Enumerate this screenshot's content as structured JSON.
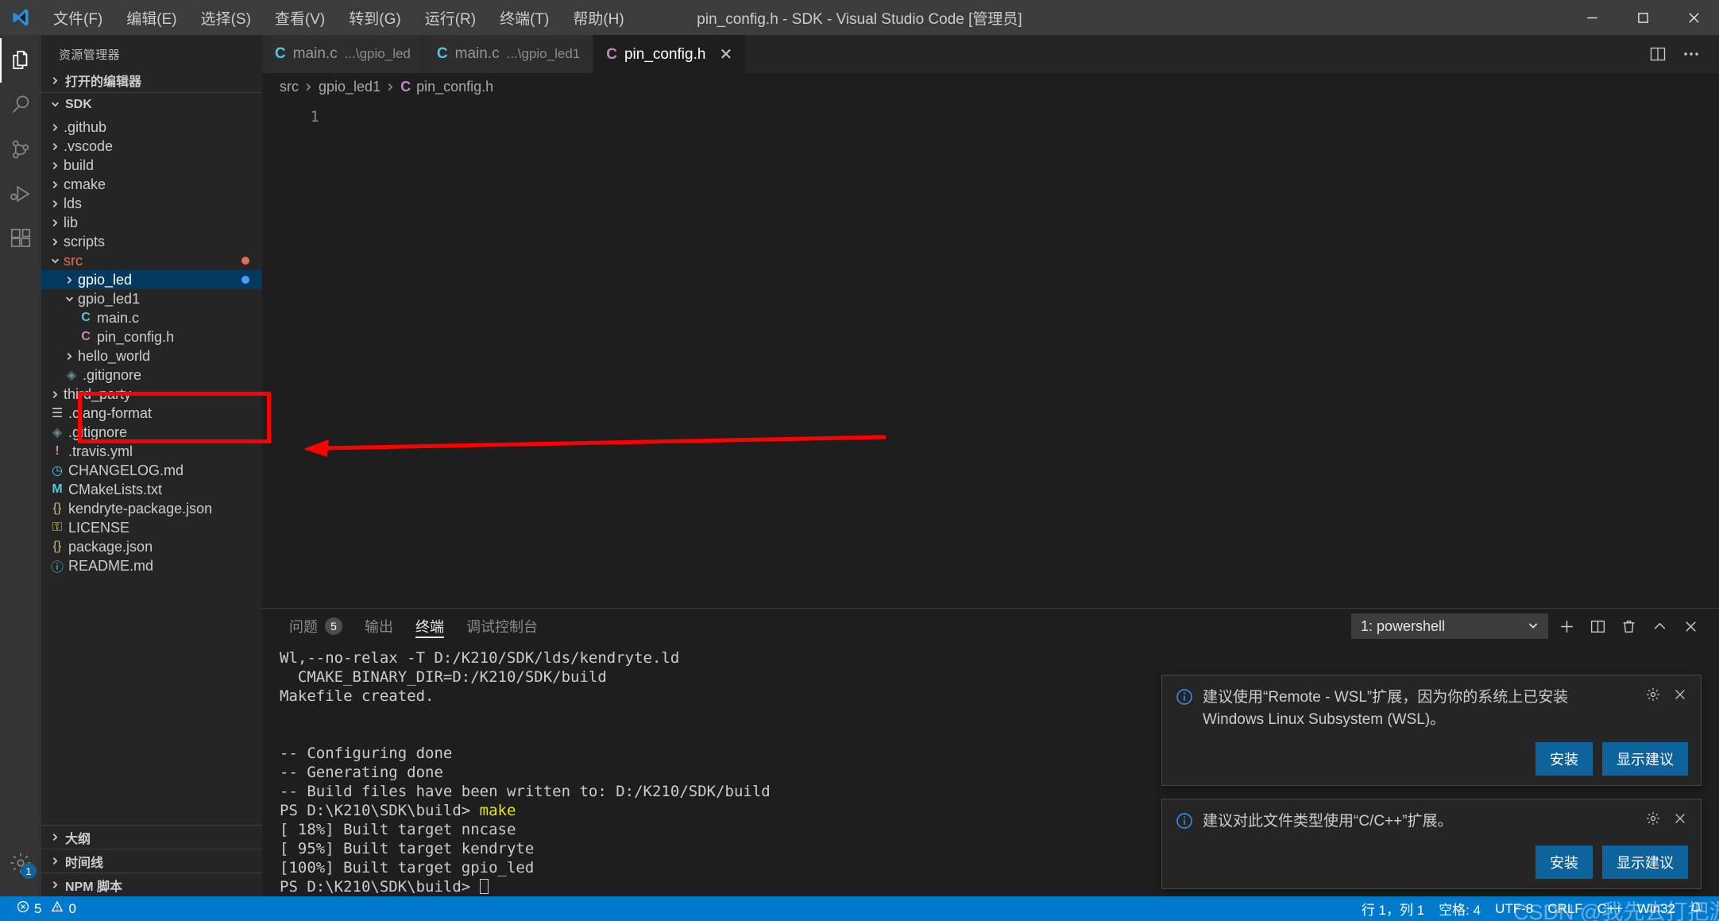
{
  "titlebar": {
    "app_icon": "vscode-logo-icon",
    "window_title": "pin_config.h - SDK - Visual Studio Code [管理员]",
    "menu": [
      {
        "label": "文件(F)",
        "name": "menu-file"
      },
      {
        "label": "编辑(E)",
        "name": "menu-edit"
      },
      {
        "label": "选择(S)",
        "name": "menu-selection"
      },
      {
        "label": "查看(V)",
        "name": "menu-view"
      },
      {
        "label": "转到(G)",
        "name": "menu-goto"
      },
      {
        "label": "运行(R)",
        "name": "menu-run"
      },
      {
        "label": "终端(T)",
        "name": "menu-terminal"
      },
      {
        "label": "帮助(H)",
        "name": "menu-help"
      }
    ],
    "window_controls": [
      "minimize-icon",
      "maximize-icon",
      "close-icon"
    ]
  },
  "activitybar": {
    "items": [
      {
        "icon": "explorer-files-icon",
        "active": true
      },
      {
        "icon": "search-icon",
        "active": false
      },
      {
        "icon": "source-control-branch-icon",
        "active": false
      },
      {
        "icon": "run-and-debug-icon",
        "active": false
      },
      {
        "icon": "extensions-icon",
        "active": false
      }
    ],
    "manage": {
      "icon": "gear-icon",
      "badge": "1"
    }
  },
  "sidebar": {
    "title": "资源管理器",
    "sections": {
      "open_editors": "打开的编辑器",
      "outline": "大纲",
      "timeline": "时间线",
      "npm_scripts": "NPM 脚本"
    },
    "root": "SDK",
    "tree": [
      {
        "label": ".github",
        "type": "folder",
        "depth": 1,
        "expanded": false
      },
      {
        "label": ".vscode",
        "type": "folder",
        "depth": 1,
        "expanded": false
      },
      {
        "label": "build",
        "type": "folder",
        "depth": 1,
        "expanded": false
      },
      {
        "label": "cmake",
        "type": "folder",
        "depth": 1,
        "expanded": false
      },
      {
        "label": "lds",
        "type": "folder",
        "depth": 1,
        "expanded": false
      },
      {
        "label": "lib",
        "type": "folder",
        "depth": 1,
        "expanded": false
      },
      {
        "label": "scripts",
        "type": "folder",
        "depth": 1,
        "expanded": false
      },
      {
        "label": "src",
        "type": "folder",
        "depth": 1,
        "expanded": true,
        "modified": true,
        "badge_dot": "#e06c5b"
      },
      {
        "label": "gpio_led",
        "type": "folder",
        "depth": 2,
        "expanded": false,
        "selected": true,
        "badge_dot": "#4a9eff"
      },
      {
        "label": "gpio_led1",
        "type": "folder",
        "depth": 2,
        "expanded": true
      },
      {
        "label": "main.c",
        "type": "file-c",
        "depth": 3
      },
      {
        "label": "pin_config.h",
        "type": "file-h",
        "depth": 3
      },
      {
        "label": "hello_world",
        "type": "folder",
        "depth": 2,
        "expanded": false
      },
      {
        "label": ".gitignore",
        "type": "file-git",
        "depth": 2
      },
      {
        "label": "third_party",
        "type": "folder",
        "depth": 1,
        "expanded": false
      },
      {
        "label": ".clang-format",
        "type": "file-config",
        "depth": 1
      },
      {
        "label": ".gitignore",
        "type": "file-git",
        "depth": 1
      },
      {
        "label": ".travis.yml",
        "type": "file-travis",
        "depth": 1
      },
      {
        "label": "CHANGELOG.md",
        "type": "file-changelog",
        "depth": 1
      },
      {
        "label": "CMakeLists.txt",
        "type": "file-cmake",
        "depth": 1
      },
      {
        "label": "kendryte-package.json",
        "type": "file-json",
        "depth": 1
      },
      {
        "label": "LICENSE",
        "type": "file-license",
        "depth": 1
      },
      {
        "label": "package.json",
        "type": "file-json",
        "depth": 1
      },
      {
        "label": "README.md",
        "type": "file-readme",
        "depth": 1
      }
    ]
  },
  "editor": {
    "tabs": [
      {
        "icon": "c-file-icon",
        "name": "main.c",
        "path": "...\\gpio_led",
        "active": false,
        "closable": false
      },
      {
        "icon": "c-file-icon",
        "name": "main.c",
        "path": "...\\gpio_led1",
        "active": false,
        "closable": false
      },
      {
        "icon": "h-file-icon",
        "name": "pin_config.h",
        "path": "",
        "active": true,
        "closable": true
      }
    ],
    "tab_actions": [
      "split-editor-icon",
      "more-actions-icon"
    ],
    "breadcrumb": [
      "src",
      "gpio_led1",
      "pin_config.h"
    ],
    "line_numbers": [
      "1"
    ],
    "content_lines": [
      ""
    ]
  },
  "panel": {
    "tabs": [
      {
        "label": "问题",
        "badge": "5",
        "active": false
      },
      {
        "label": "输出",
        "badge": "",
        "active": false
      },
      {
        "label": "终端",
        "badge": "",
        "active": true
      },
      {
        "label": "调试控制台",
        "badge": "",
        "active": false
      }
    ],
    "terminal_select": "1: powershell",
    "actions": [
      "new-terminal-icon",
      "split-terminal-icon",
      "kill-terminal-icon",
      "maximize-panel-icon",
      "close-panel-icon"
    ],
    "terminal_lines": [
      {
        "text": "Wl,--no-relax -T D:/K210/SDK/lds/kendryte.ld",
        "color": "default"
      },
      {
        "text": "  CMAKE_BINARY_DIR=D:/K210/SDK/build",
        "color": "default"
      },
      {
        "text": "Makefile created.",
        "color": "default"
      },
      {
        "text": "",
        "color": "default"
      },
      {
        "text": "",
        "color": "default"
      },
      {
        "text": "-- Configuring done",
        "color": "default"
      },
      {
        "text": "-- Generating done",
        "color": "default"
      },
      {
        "text": "-- Build files have been written to: D:/K210/SDK/build",
        "color": "default"
      },
      {
        "text": "PS D:\\K210\\SDK\\build> ",
        "suffix": "make",
        "color": "prompt"
      },
      {
        "text": "[ 18%] Built target nncase",
        "color": "default"
      },
      {
        "text": "[ 95%] Built target kendryte",
        "color": "default"
      },
      {
        "text": "[100%] Built target gpio_led",
        "color": "default"
      },
      {
        "text": "PS D:\\K210\\SDK\\build> ",
        "suffix": "",
        "color": "cursor"
      }
    ]
  },
  "notifications": [
    {
      "icon": "info-icon",
      "message": "建议使用“Remote - WSL”扩展，因为你的系统上已安装 Windows Linux Subsystem (WSL)。",
      "gear": "gear-icon",
      "close": "close-icon",
      "buttons": [
        "安装",
        "显示建议"
      ]
    },
    {
      "icon": "info-icon",
      "message": "建议对此文件类型使用“C/C++”扩展。",
      "gear": "gear-icon",
      "close": "close-icon",
      "buttons": [
        "安装",
        "显示建议"
      ]
    }
  ],
  "statusbar": {
    "left": [
      {
        "icon": "error-icon",
        "label": "5"
      },
      {
        "icon": "warning-icon",
        "label": "0"
      }
    ],
    "right": [
      {
        "label": "行 1，列 1",
        "name": "cursor-position"
      },
      {
        "label": "空格: 4",
        "name": "indentation"
      },
      {
        "label": "UTF-8",
        "name": "encoding"
      },
      {
        "label": "CRLF",
        "name": "eol"
      },
      {
        "label": "C++",
        "name": "language-mode"
      },
      {
        "label": "Win32",
        "name": "platform"
      },
      {
        "icon": "bell-icon",
        "label": "",
        "name": "notifications-bell"
      }
    ]
  },
  "annotation": {
    "red_box": "highlight-new-files-box",
    "red_arrow": "pointer-arrow",
    "color": "#ff0000"
  },
  "watermark": {
    "text": "CSDN @我先去打把游戏先"
  }
}
